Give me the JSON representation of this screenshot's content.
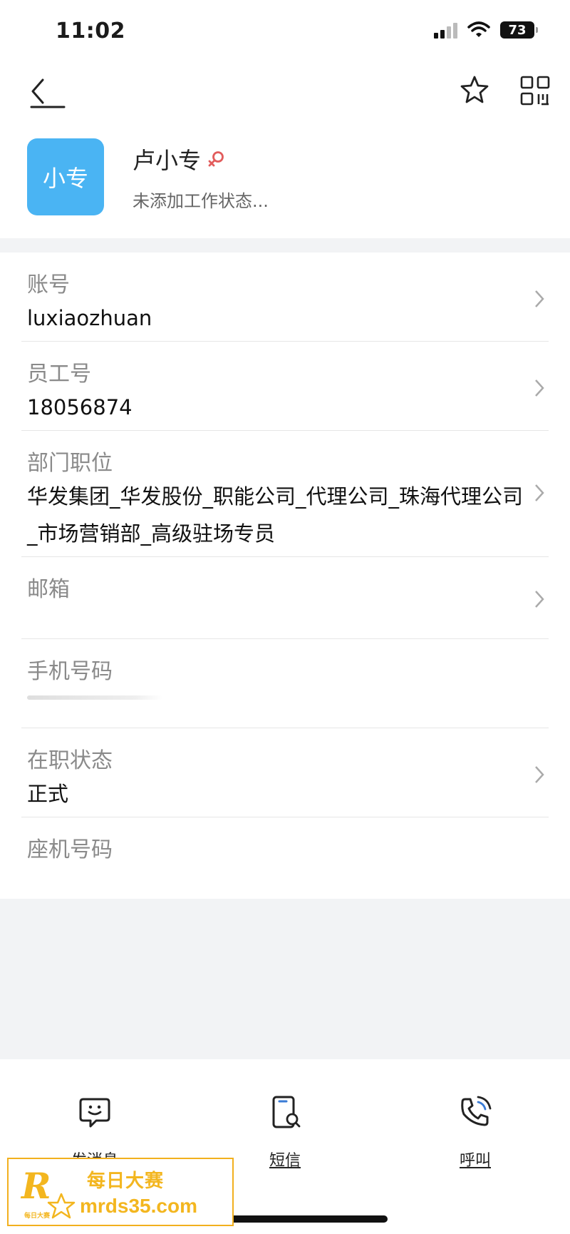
{
  "status_bar": {
    "time": "11:02",
    "battery": "73"
  },
  "profile": {
    "avatar_text": "小专",
    "name": "卢小专",
    "status": "未添加工作状态..."
  },
  "fields": [
    {
      "label": "账号",
      "value": "luxiaozhuan"
    },
    {
      "label": "员工号",
      "value": "18056874"
    },
    {
      "label": "部门职位",
      "value": "华发集团_华发股份_职能公司_代理公司_珠海代理公司_市场营销部_高级驻场专员"
    },
    {
      "label": "邮箱",
      "value": ""
    },
    {
      "label": "手机号码",
      "value": ""
    },
    {
      "label": "在职状态",
      "value": "正式"
    },
    {
      "label": "座机号码",
      "value": ""
    }
  ],
  "actions": [
    {
      "label": "发消息",
      "icon": "chat-bubble-icon"
    },
    {
      "label": "短信",
      "icon": "sms-phone-icon"
    },
    {
      "label": "呼叫",
      "icon": "phone-call-icon"
    }
  ],
  "promo": {
    "logo": "R",
    "logo_sub": "每日大赛",
    "title": "每日大赛",
    "url": "mrds35.com"
  },
  "colors": {
    "avatar": "#4ab4f3",
    "accent": "#f3b61f",
    "gender": "#e25c5c"
  }
}
